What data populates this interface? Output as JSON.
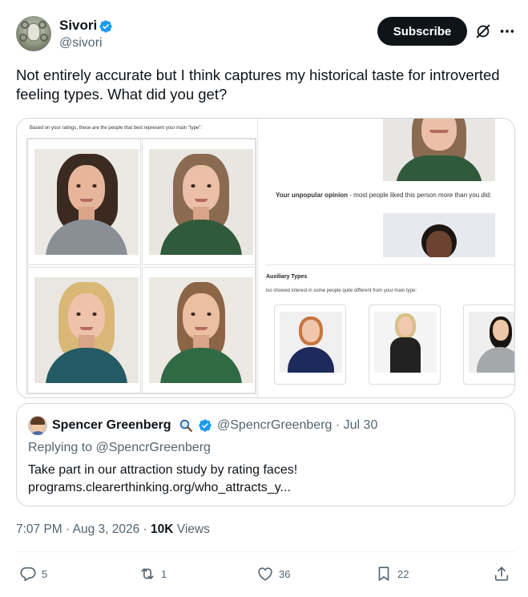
{
  "author": {
    "display_name": "Sivori",
    "handle": "@sivori"
  },
  "header": {
    "subscribe_label": "Subscribe"
  },
  "tweet": {
    "text": "Not entirely accurate but I think captures my historical taste for introverted feeling types. What did you get?"
  },
  "media": {
    "rank_caption": "Based on your ratings, these are the people that best represent your main \"type\":",
    "unpopular_label": "Your unpopular opinion",
    "unpopular_text": " - most people liked this person more than you did:",
    "aux_title": "Auxiliary Types",
    "aux_subtitle": "lso showed interest in some people quite different from your main type:"
  },
  "quote": {
    "name": "Spencer Greenberg",
    "handle_date": "@SpencrGreenberg · Jul 30",
    "replying_to": "Replying to @SpencrGreenberg",
    "text_line1": "Take part in our attraction study by rating faces!",
    "text_line2": "programs.clearerthinking.org/who_attracts_y..."
  },
  "meta": {
    "time_date": "7:07 PM · Aug 3, 2026 · ",
    "views_count": "10K",
    "views_label": " Views"
  },
  "actions": {
    "replies": "5",
    "reposts": "1",
    "likes": "36",
    "bookmarks": "22"
  },
  "colors": {
    "verified_blue": "#1d9bf0",
    "text_primary": "#0f1419",
    "text_secondary": "#536471",
    "border": "#cfd9de"
  },
  "icons": [
    "verified-badge-icon",
    "grok-icon",
    "more-icon",
    "search-icon",
    "reply-icon",
    "repost-icon",
    "like-icon",
    "bookmark-icon",
    "share-icon"
  ]
}
